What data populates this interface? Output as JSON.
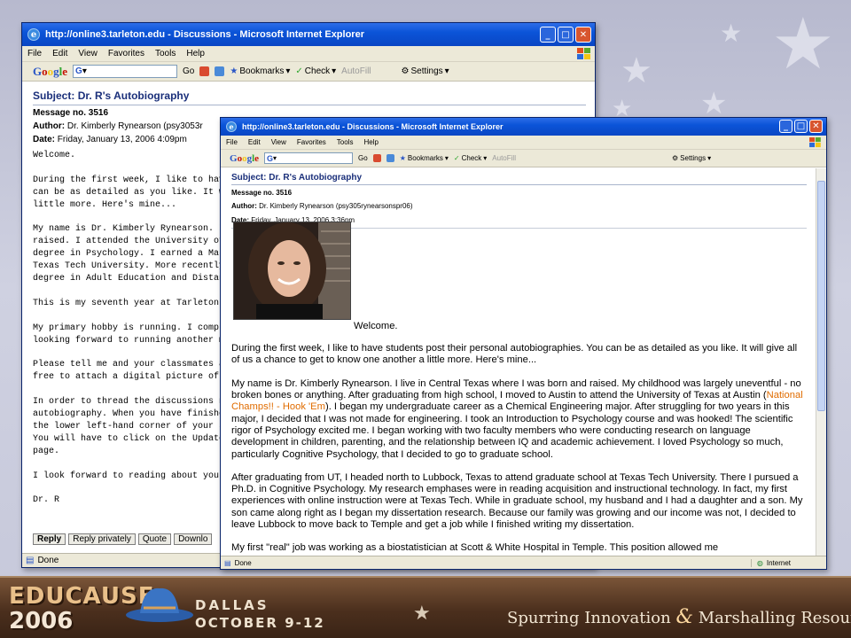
{
  "back_window": {
    "title": "http://online3.tarleton.edu - Discussions - Microsoft Internet Explorer",
    "menu": [
      "File",
      "Edit",
      "View",
      "Favorites",
      "Tools",
      "Help"
    ],
    "toolbar": {
      "google_logo": "Google",
      "go": "Go",
      "bookmarks": "Bookmarks",
      "check": "Check",
      "autofill": "AutoFill",
      "settings": "Settings"
    },
    "subject_label": "Subject:",
    "subject_value": "Dr. R's Autobiography",
    "message_label": "Message no. 3516",
    "author_label": "Author:",
    "author_value": "Dr. Kimberly Rynearson (psy3053r",
    "date_label": "Date:",
    "date_value": "Friday, January 13, 2006 4:09pm",
    "body_lines": [
      "Welcome.",
      "",
      "During the first week, I like to hav",
      "can be as detailed as you like. It w",
      "little more. Here's mine...",
      "",
      "My name is Dr. Kimberly Rynearson. I",
      "raised. I attended the University of",
      "degree in Psychology. I earned a Mas",
      "Texas Tech University. More recently",
      "degree in Adult Education and Distan",
      "",
      "This is my seventh year at Tarleton.",
      "",
      "My primary hobby is running. I compl",
      "looking forward to running another m",
      "",
      "Please tell me and your classmates a",
      "free to attach a digital picture of",
      "",
      "In order to thread the discussions n",
      "autobiography. When you have finishe",
      "the lower left-hand corner of your s",
      "You will have to click on the Update",
      "page.",
      "",
      "I look forward to reading about you.",
      "",
      "Dr. R"
    ],
    "buttons": [
      "Reply",
      "Reply privately",
      "Quote",
      "Downlo"
    ],
    "status": "Done"
  },
  "front_window": {
    "title": "http://online3.tarleton.edu - Discussions - Microsoft Internet Explorer",
    "menu": [
      "File",
      "Edit",
      "View",
      "Favorites",
      "Tools",
      "Help"
    ],
    "toolbar": {
      "google_logo": "Google",
      "go": "Go",
      "bookmarks": "Bookmarks",
      "check": "Check",
      "autofill": "AutoFill",
      "settings": "Settings"
    },
    "subject_label": "Subject:",
    "subject_value": "Dr. R's Autobiography",
    "message_label": "Message no. 3516",
    "author_label": "Author:",
    "author_value": "Dr. Kimberly Rynearson (psy305rynearsonspr06)",
    "date_label": "Date:",
    "date_value": "Friday, January 13, 2006 3:36pm",
    "welcome": "Welcome.",
    "para1": "During the first week, I like to have students post their personal autobiographies. You can be as detailed as you like. It will give all of us a chance to get to know one another a little more. Here's mine...",
    "para2_a": "My name is Dr. Kimberly Rynearson. I live in Central Texas where I was born and raised. My childhood was largely uneventful - no broken bones or anything. After graduating from high school, I moved to Austin to attend the University of Texas at Austin (",
    "para2_highlight": "National Champs!! - Hook 'Em",
    "para2_b": "). I began my undergraduate career as a Chemical Engineering major. After struggling for two years in this major, I decided that I was not made for engineering. I took an Introduction to Psychology course and was hooked! The scientific rigor of Psychology excited me. I began working with two faculty members who were conducting research on language development in children, parenting, and the relationship between IQ and academic achievement. I loved Psychology so much, particularly Cognitive Psychology, that I decided to go to graduate school.",
    "para3": "After graduating from UT, I headed north to Lubbock, Texas to attend graduate school at Texas Tech University. There I pursued a Ph.D. in Cognitive Psychology. My research emphases were in reading acquisition and instructional technology. In fact, my first experiences with online instruction were at Texas Tech. While in graduate school, my husband and I had a daughter and a son. My son came along right as I began my dissertation research. Because our family was growing and our income was not, I decided to leave Lubbock to move back to Temple and get a job while I finished writing my dissertation.",
    "para4": "My first \"real\" job was working as a biostatistician at Scott & White Hospital in Temple. This position allowed me",
    "status": "Done",
    "zone": "Internet"
  },
  "banner": {
    "logo_text": "EDUCAUSE",
    "year": "2006",
    "city": "Dallas",
    "dates": "October 9-12",
    "tagline_a": "Spurring Innovation ",
    "tagline_amp": "&",
    "tagline_b": " Marshalling Resources"
  },
  "colors": {
    "title_blue": "#0b54d8",
    "subject_navy": "#1a2f7a",
    "highlight_orange": "#e06c00",
    "banner_brown": "#4b2f1d"
  }
}
